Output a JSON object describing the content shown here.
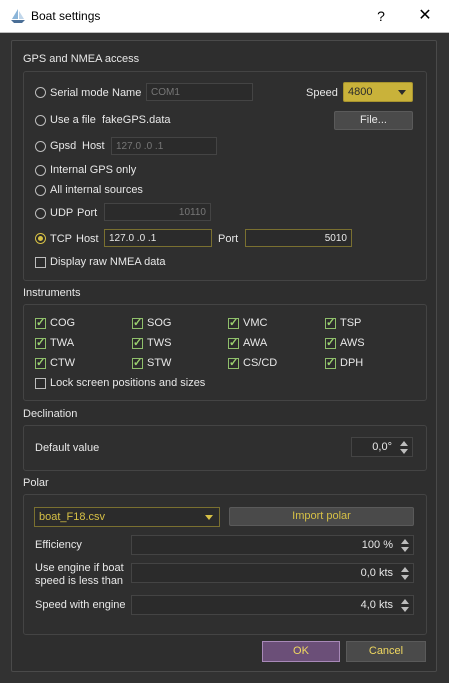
{
  "window": {
    "title": "Boat settings",
    "help": "?",
    "close": "✕"
  },
  "gps": {
    "section_title": "GPS and NMEA access",
    "serial_label": "Serial mode",
    "name_label": "Name",
    "name_value": "COM1",
    "speed_label": "Speed",
    "speed_value": "4800",
    "file_label": "Use a file",
    "file_name": "fakeGPS.data",
    "file_button": "File...",
    "gpsd_label": "Gpsd",
    "gpsd_host_label": "Host",
    "gpsd_host_value": "127.0 .0 .1",
    "internal_gps_label": "Internal GPS only",
    "all_internal_label": "All internal sources",
    "udp_label": "UDP",
    "udp_port_label": "Port",
    "udp_port_value": "10110",
    "tcp_label": "TCP",
    "tcp_host_label": "Host",
    "tcp_host_value": "127.0 .0 .1",
    "tcp_port_label": "Port",
    "tcp_port_value": "5010",
    "raw_nmea_label": "Display raw NMEA data",
    "selected_source": "TCP"
  },
  "instruments": {
    "section_title": "Instruments",
    "items": [
      "COG",
      "SOG",
      "VMC",
      "TSP",
      "TWA",
      "TWS",
      "AWA",
      "AWS",
      "CTW",
      "STW",
      "CS/CD",
      "DPH"
    ],
    "lock_label": "Lock screen positions and sizes"
  },
  "declination": {
    "section_title": "Declination",
    "default_label": "Default value",
    "default_value": "0,0°"
  },
  "polar": {
    "section_title": "Polar",
    "file_value": "boat_F18.csv",
    "import_button": "Import polar",
    "efficiency_label": "Efficiency",
    "efficiency_value": "100 %",
    "engine_label_1": "Use engine if boat",
    "engine_label_2": "speed is less than",
    "engine_value": "0,0 kts",
    "speed_engine_label": "Speed with engine",
    "speed_engine_value": "4,0 kts"
  },
  "buttons": {
    "ok": "OK",
    "cancel": "Cancel"
  },
  "colors": {
    "accent": "#d6c046",
    "background": "#323232",
    "check": "#9bd16e",
    "ok_bg": "#6b4f78"
  }
}
